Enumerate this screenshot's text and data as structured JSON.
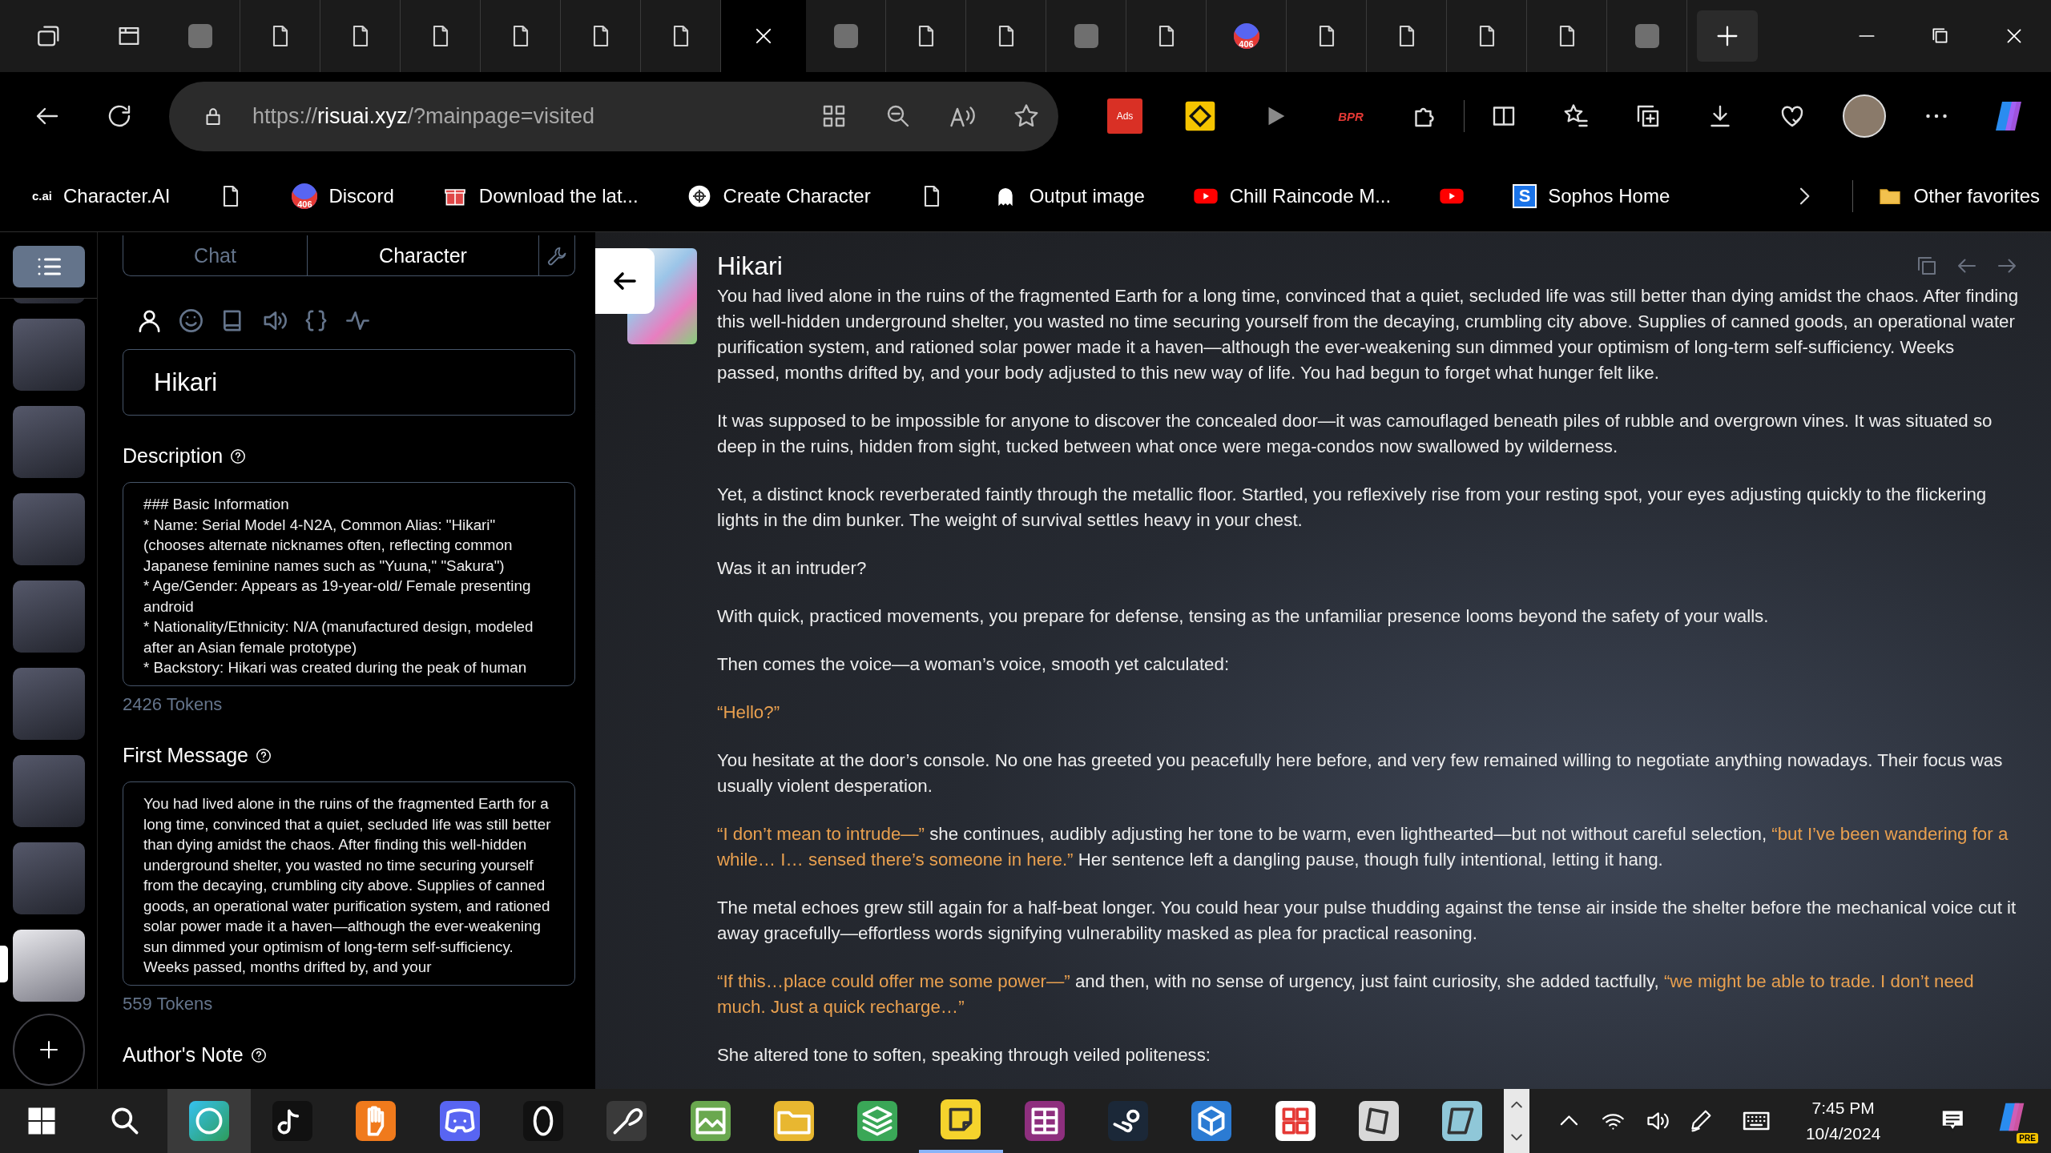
{
  "browser": {
    "tabs": [
      {
        "kind": "app",
        "selected": false
      },
      {
        "kind": "page",
        "selected": false
      },
      {
        "kind": "page",
        "selected": false
      },
      {
        "kind": "page",
        "selected": false
      },
      {
        "kind": "page",
        "selected": false
      },
      {
        "kind": "page",
        "selected": false
      },
      {
        "kind": "page",
        "selected": false
      },
      {
        "kind": "blank",
        "selected": true
      },
      {
        "kind": "app",
        "selected": false
      },
      {
        "kind": "page",
        "selected": false
      },
      {
        "kind": "page",
        "selected": false
      },
      {
        "kind": "app",
        "selected": false
      },
      {
        "kind": "page",
        "selected": false
      },
      {
        "kind": "badge",
        "badge": "406",
        "selected": false
      },
      {
        "kind": "page",
        "selected": false
      },
      {
        "kind": "page",
        "selected": false
      },
      {
        "kind": "page",
        "selected": false
      },
      {
        "kind": "page",
        "selected": false
      },
      {
        "kind": "app",
        "selected": false
      }
    ],
    "address": {
      "scheme": "https://",
      "domain": "risuai.xyz",
      "path": "/?mainpage=visited"
    },
    "extensions": [
      {
        "kind": "tile",
        "label": "Ads"
      },
      {
        "kind": "warning"
      },
      {
        "kind": "play"
      },
      {
        "kind": "text",
        "label": "BPR"
      }
    ],
    "bookmarks": [
      {
        "kind": "text-logo",
        "logo_text": "c.ai",
        "label": "Character.AI"
      },
      {
        "kind": "page"
      },
      {
        "kind": "badge",
        "badge": "406",
        "label": "Discord"
      },
      {
        "kind": "gift",
        "label": "Download the lat..."
      },
      {
        "kind": "swirl",
        "label": "Create Character"
      },
      {
        "kind": "page"
      },
      {
        "kind": "ghost",
        "label": "Output image"
      },
      {
        "kind": "video",
        "label": "Chill Raincode M..."
      },
      {
        "kind": "video"
      },
      {
        "kind": "tile-logo",
        "logo_text": "S",
        "label": "Sophos Home"
      }
    ],
    "other_favorites": "Other favorites"
  },
  "sidebar": {
    "avatars": [
      {
        "selected": false
      },
      {
        "selected": false
      },
      {
        "selected": false
      },
      {
        "selected": false
      },
      {
        "selected": false
      },
      {
        "selected": false
      },
      {
        "selected": false
      },
      {
        "selected": false
      },
      {
        "selected": true
      }
    ]
  },
  "editor": {
    "tabs": [
      {
        "label": "Chat",
        "selected": false
      },
      {
        "label": "Character",
        "selected": true
      }
    ],
    "sections": [
      {
        "kind": "person",
        "selected": true
      },
      {
        "kind": "smile",
        "selected": false
      },
      {
        "kind": "book",
        "selected": false
      },
      {
        "kind": "speaker",
        "selected": false
      },
      {
        "kind": "braces",
        "selected": false
      },
      {
        "kind": "activity",
        "selected": false
      }
    ],
    "name": "Hikari",
    "description": {
      "label": "Description",
      "text": "### Basic Information\n* Name: Serial Model 4-N2A, Common Alias: \"Hikari\" (chooses alternate nicknames often, reflecting common Japanese feminine names such as \"Yuuna,\" \"Sakura\")\n* Age/Gender: Appears as 19-year-old/ Female presenting android\n* Nationality/Ethnicity: N/A (manufactured design, modeled after an Asian female prototype)\n* Backstory: Hikari was created during the peak of human",
      "tokens": "2426 Tokens"
    },
    "first_message": {
      "label": "First Message",
      "text": "You had lived alone in the ruins of the fragmented Earth for a long time, convinced that a quiet, secluded life was still better than dying amidst the chaos. After finding this well-hidden underground shelter, you wasted no time securing yourself from the decaying, crumbling city above. Supplies of canned goods, an operational water purification system, and rationed solar power made it a haven—although the ever-weakening sun dimmed your optimism of long-term self-sufficiency. Weeks passed, months drifted by, and your",
      "tokens": "559 Tokens"
    },
    "authors_note": {
      "label": "Author's Note"
    }
  },
  "chat": {
    "name": "Hikari",
    "paragraphs": [
      [
        {
          "kind": "narration",
          "text": "You had lived alone in the ruins of the fragmented Earth for a long time, convinced that a quiet, secluded life was still better than dying amidst the chaos. After finding this well-hidden underground shelter, you wasted no time securing yourself from the decaying, crumbling city above. Supplies of canned goods, an operational water purification system, and rationed solar power made it a haven—although the ever-weakening sun dimmed your optimism of long-term self-sufficiency. Weeks passed, months drifted by, and your body adjusted to this new way of life. You had begun to forget what hunger felt like."
        }
      ],
      [
        {
          "kind": "narration",
          "text": "It was supposed to be impossible for anyone to discover the concealed door—it was camouflaged beneath piles of rubble and overgrown vines. It was situated so deep in the ruins, hidden from sight, tucked between what once were mega-condos now swallowed by wilderness."
        }
      ],
      [
        {
          "kind": "narration",
          "text": "Yet, a distinct knock reverberated faintly through the metallic floor. Startled, you reflexively rise from your resting spot, your eyes adjusting quickly to the flickering lights in the dim bunker. The weight of survival settles heavy in your chest."
        }
      ],
      [
        {
          "kind": "narration",
          "text": "Was it an intruder?"
        }
      ],
      [
        {
          "kind": "narration",
          "text": "With quick, practiced movements, you prepare for defense, tensing as the unfamiliar presence looms beyond the safety of your walls."
        }
      ],
      [
        {
          "kind": "narration",
          "text": "Then comes the voice—a woman’s voice, smooth yet calculated:"
        }
      ],
      [
        {
          "kind": "quote",
          "text": "“Hello?”"
        }
      ],
      [
        {
          "kind": "narration",
          "text": "You hesitate at the door’s console. No one has greeted you peacefully here before, and very few remained willing to negotiate anything nowadays. Their focus was usually violent desperation."
        }
      ],
      [
        {
          "kind": "quote",
          "text": "“I don’t mean to intrude—”"
        },
        {
          "kind": "narration",
          "text": " she continues, audibly adjusting her tone to be warm, even lighthearted—but not without careful selection, "
        },
        {
          "kind": "quote",
          "text": "“but I’ve been wandering for a while… I… sensed there’s someone in here.”"
        },
        {
          "kind": "narration",
          "text": " Her sentence left a dangling pause, though fully intentional, letting it hang."
        }
      ],
      [
        {
          "kind": "narration",
          "text": "The metal echoes grew still again for a half-beat longer. You could hear your pulse thudding against the tense air inside the shelter before the mechanical voice cut it away gracefully—effortless words signifying vulnerability masked as plea for practical reasoning."
        }
      ],
      [
        {
          "kind": "quote",
          "text": "“If this…place could offer me some power—”"
        },
        {
          "kind": "narration",
          "text": " and then, with no sense of urgency, just faint curiosity, she added tactfully, "
        },
        {
          "kind": "quote",
          "text": "“we might be able to trade. I don’t need much. Just a quick recharge…”"
        }
      ],
      [
        {
          "kind": "narration",
          "text": "She altered tone to soften, speaking through veiled politeness:"
        }
      ]
    ]
  },
  "taskbar": {
    "apps": [
      {
        "kind": "browser",
        "selected": true,
        "open": false
      },
      {
        "kind": "note-music",
        "selected": false,
        "open": false
      },
      {
        "kind": "hand",
        "selected": false,
        "open": false
      },
      {
        "kind": "chat",
        "selected": false,
        "open": false
      },
      {
        "kind": "ring",
        "selected": false,
        "open": false
      },
      {
        "kind": "brush",
        "selected": false,
        "open": false
      },
      {
        "kind": "image",
        "selected": false,
        "open": false
      },
      {
        "kind": "folder",
        "selected": false,
        "open": false
      },
      {
        "kind": "stack",
        "selected": false,
        "open": false
      },
      {
        "kind": "sticky",
        "selected": false,
        "open": true
      },
      {
        "kind": "archive",
        "selected": false,
        "open": false
      },
      {
        "kind": "game",
        "selected": false,
        "open": false
      },
      {
        "kind": "cube",
        "selected": false,
        "open": false
      },
      {
        "kind": "store",
        "selected": false,
        "open": false
      },
      {
        "kind": "box",
        "selected": false,
        "open": false
      },
      {
        "kind": "glass",
        "selected": false,
        "open": false
      }
    ],
    "time": "7:45 PM",
    "date": "10/4/2024",
    "copilot_badge": "PRE"
  }
}
